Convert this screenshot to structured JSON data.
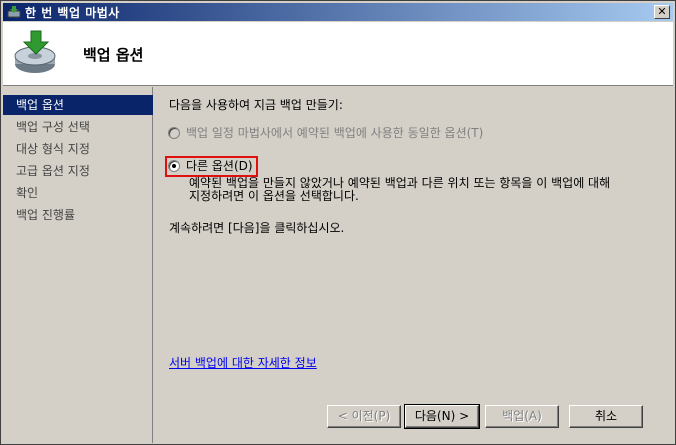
{
  "window": {
    "title": "한 번 백업 마법사"
  },
  "header": {
    "title": "백업 옵션"
  },
  "sidebar": {
    "items": [
      {
        "label": "백업 옵션"
      },
      {
        "label": "백업 구성 선택"
      },
      {
        "label": "대상 형식 지정"
      },
      {
        "label": "고급 옵션 지정"
      },
      {
        "label": "확인"
      },
      {
        "label": "백업 진행률"
      }
    ]
  },
  "main": {
    "prompt": "다음을 사용하여 지금 백업 만들기:",
    "option_scheduled": {
      "label": "백업 일정 마법사에서 예약된 백업에 사용한 동일한 옵션(T)",
      "enabled": false,
      "checked": false
    },
    "option_different": {
      "label": "다른 옵션(D)",
      "checked": true,
      "description_line1": "예약된 백업을 만들지 않았거나 예약된 백업과 다른 위치 또는 항목을 이 백업에 대해",
      "description_line2": "지정하려면 이 옵션을 선택합니다."
    },
    "continue_text": "계속하려면 [다음]을 클릭하십시오.",
    "more_info_link": "서버 백업에 대한 자세한 정보"
  },
  "buttons": {
    "previous": "< 이전(P)",
    "next": "다음(N) >",
    "backup": "백업(A)",
    "cancel": "취소"
  },
  "colors": {
    "highlight_box": "#e01010",
    "title_bar": "#0a246a",
    "selected_item": "#0a246a",
    "link": "#0000ee"
  }
}
